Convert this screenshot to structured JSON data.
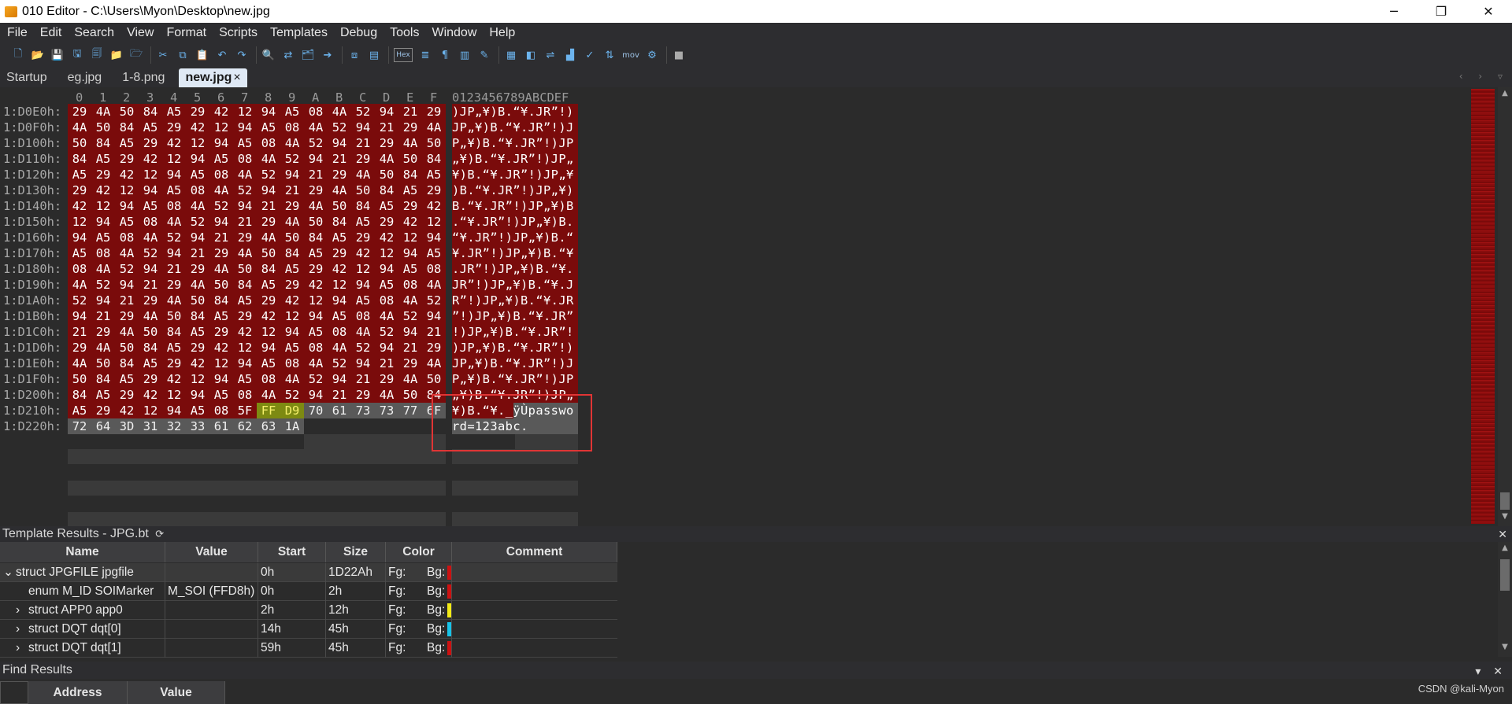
{
  "window": {
    "title": "010 Editor - C:\\Users\\Myon\\Desktop\\new.jpg",
    "minimize_glyph": "─",
    "restore_glyph": "❐",
    "close_glyph": "✕"
  },
  "menu": [
    "File",
    "Edit",
    "Search",
    "View",
    "Format",
    "Scripts",
    "Templates",
    "Debug",
    "Tools",
    "Window",
    "Help"
  ],
  "toolbar": {
    "icons": [
      "new-file-icon",
      "open-file-icon",
      "save-icon",
      "save-as-icon",
      "save-all-icon",
      "open-folder-icon",
      "open-project-icon",
      "cut-icon",
      "copy-icon",
      "paste-icon",
      "undo-icon",
      "redo-icon",
      "find-icon",
      "replace-icon",
      "find-in-files-icon",
      "goto-icon",
      "compare-icon",
      "template-icon",
      "hex-mode-icon",
      "text-mode-icon",
      "paragraph-icon",
      "columns-icon",
      "highlighter-icon",
      "calculator-icon",
      "inspector-icon",
      "convert-icon",
      "histogram-icon",
      "checksum-icon",
      "sort-icon",
      "mov-icon",
      "script-icon",
      "stop-icon"
    ],
    "hex_label": "Hex",
    "mov_label": "mov"
  },
  "tabs": [
    {
      "label": "Startup",
      "active": false
    },
    {
      "label": "eg.jpg",
      "active": false
    },
    {
      "label": "1-8.png",
      "active": false
    },
    {
      "label": "new.jpg",
      "active": true
    }
  ],
  "tab_close_glyph": "×",
  "hex": {
    "columns": [
      "0",
      "1",
      "2",
      "3",
      "4",
      "5",
      "6",
      "7",
      "8",
      "9",
      "A",
      "B",
      "C",
      "D",
      "E",
      "F"
    ],
    "ascii_header": "0123456789ABCDEF",
    "rows": [
      {
        "addr": "1:D0E0h:",
        "bytes": [
          "29",
          "4A",
          "50",
          "84",
          "A5",
          "29",
          "42",
          "12",
          "94",
          "A5",
          "08",
          "4A",
          "52",
          "94",
          "21",
          "29"
        ],
        "ascii": ")JP„¥)B.“¥.JR”!)"
      },
      {
        "addr": "1:D0F0h:",
        "bytes": [
          "4A",
          "50",
          "84",
          "A5",
          "29",
          "42",
          "12",
          "94",
          "A5",
          "08",
          "4A",
          "52",
          "94",
          "21",
          "29",
          "4A"
        ],
        "ascii": "JP„¥)B.“¥.JR”!)J"
      },
      {
        "addr": "1:D100h:",
        "bytes": [
          "50",
          "84",
          "A5",
          "29",
          "42",
          "12",
          "94",
          "A5",
          "08",
          "4A",
          "52",
          "94",
          "21",
          "29",
          "4A",
          "50"
        ],
        "ascii": "P„¥)B.“¥.JR”!)JP"
      },
      {
        "addr": "1:D110h:",
        "bytes": [
          "84",
          "A5",
          "29",
          "42",
          "12",
          "94",
          "A5",
          "08",
          "4A",
          "52",
          "94",
          "21",
          "29",
          "4A",
          "50",
          "84"
        ],
        "ascii": "„¥)B.“¥.JR”!)JP„"
      },
      {
        "addr": "1:D120h:",
        "bytes": [
          "A5",
          "29",
          "42",
          "12",
          "94",
          "A5",
          "08",
          "4A",
          "52",
          "94",
          "21",
          "29",
          "4A",
          "50",
          "84",
          "A5"
        ],
        "ascii": "¥)B.“¥.JR”!)JP„¥"
      },
      {
        "addr": "1:D130h:",
        "bytes": [
          "29",
          "42",
          "12",
          "94",
          "A5",
          "08",
          "4A",
          "52",
          "94",
          "21",
          "29",
          "4A",
          "50",
          "84",
          "A5",
          "29"
        ],
        "ascii": ")B.“¥.JR”!)JP„¥)"
      },
      {
        "addr": "1:D140h:",
        "bytes": [
          "42",
          "12",
          "94",
          "A5",
          "08",
          "4A",
          "52",
          "94",
          "21",
          "29",
          "4A",
          "50",
          "84",
          "A5",
          "29",
          "42"
        ],
        "ascii": "B.“¥.JR”!)JP„¥)B"
      },
      {
        "addr": "1:D150h:",
        "bytes": [
          "12",
          "94",
          "A5",
          "08",
          "4A",
          "52",
          "94",
          "21",
          "29",
          "4A",
          "50",
          "84",
          "A5",
          "29",
          "42",
          "12"
        ],
        "ascii": ".“¥.JR”!)JP„¥)B."
      },
      {
        "addr": "1:D160h:",
        "bytes": [
          "94",
          "A5",
          "08",
          "4A",
          "52",
          "94",
          "21",
          "29",
          "4A",
          "50",
          "84",
          "A5",
          "29",
          "42",
          "12",
          "94"
        ],
        "ascii": "“¥.JR”!)JP„¥)B.“"
      },
      {
        "addr": "1:D170h:",
        "bytes": [
          "A5",
          "08",
          "4A",
          "52",
          "94",
          "21",
          "29",
          "4A",
          "50",
          "84",
          "A5",
          "29",
          "42",
          "12",
          "94",
          "A5"
        ],
        "ascii": "¥.JR”!)JP„¥)B.“¥"
      },
      {
        "addr": "1:D180h:",
        "bytes": [
          "08",
          "4A",
          "52",
          "94",
          "21",
          "29",
          "4A",
          "50",
          "84",
          "A5",
          "29",
          "42",
          "12",
          "94",
          "A5",
          "08"
        ],
        "ascii": ".JR”!)JP„¥)B.“¥."
      },
      {
        "addr": "1:D190h:",
        "bytes": [
          "4A",
          "52",
          "94",
          "21",
          "29",
          "4A",
          "50",
          "84",
          "A5",
          "29",
          "42",
          "12",
          "94",
          "A5",
          "08",
          "4A"
        ],
        "ascii": "JR”!)JP„¥)B.“¥.J"
      },
      {
        "addr": "1:D1A0h:",
        "bytes": [
          "52",
          "94",
          "21",
          "29",
          "4A",
          "50",
          "84",
          "A5",
          "29",
          "42",
          "12",
          "94",
          "A5",
          "08",
          "4A",
          "52"
        ],
        "ascii": "R”!)JP„¥)B.“¥.JR"
      },
      {
        "addr": "1:D1B0h:",
        "bytes": [
          "94",
          "21",
          "29",
          "4A",
          "50",
          "84",
          "A5",
          "29",
          "42",
          "12",
          "94",
          "A5",
          "08",
          "4A",
          "52",
          "94"
        ],
        "ascii": "”!)JP„¥)B.“¥.JR”"
      },
      {
        "addr": "1:D1C0h:",
        "bytes": [
          "21",
          "29",
          "4A",
          "50",
          "84",
          "A5",
          "29",
          "42",
          "12",
          "94",
          "A5",
          "08",
          "4A",
          "52",
          "94",
          "21"
        ],
        "ascii": "!)JP„¥)B.“¥.JR”!"
      },
      {
        "addr": "1:D1D0h:",
        "bytes": [
          "29",
          "4A",
          "50",
          "84",
          "A5",
          "29",
          "42",
          "12",
          "94",
          "A5",
          "08",
          "4A",
          "52",
          "94",
          "21",
          "29"
        ],
        "ascii": ")JP„¥)B.“¥.JR”!)"
      },
      {
        "addr": "1:D1E0h:",
        "bytes": [
          "4A",
          "50",
          "84",
          "A5",
          "29",
          "42",
          "12",
          "94",
          "A5",
          "08",
          "4A",
          "52",
          "94",
          "21",
          "29",
          "4A"
        ],
        "ascii": "JP„¥)B.“¥.JR”!)J"
      },
      {
        "addr": "1:D1F0h:",
        "bytes": [
          "50",
          "84",
          "A5",
          "29",
          "42",
          "12",
          "94",
          "A5",
          "08",
          "4A",
          "52",
          "94",
          "21",
          "29",
          "4A",
          "50"
        ],
        "ascii": "P„¥)B.“¥.JR”!)JP"
      },
      {
        "addr": "1:D200h:",
        "bytes": [
          "84",
          "A5",
          "29",
          "42",
          "12",
          "94",
          "A5",
          "08",
          "4A",
          "52",
          "94",
          "21",
          "29",
          "4A",
          "50",
          "84"
        ],
        "ascii": "„¥)B.“¥.JR”!)JP„"
      },
      {
        "addr": "1:D210h:",
        "bytes": [
          "A5",
          "29",
          "42",
          "12",
          "94",
          "A5",
          "08",
          "5F",
          "FF",
          "D9",
          "70",
          "61",
          "73",
          "73",
          "77",
          "6F"
        ],
        "ascii": "¥)B.“¥._ÿÙpasswo"
      },
      {
        "addr": "1:D220h:",
        "bytes": [
          "72",
          "64",
          "3D",
          "31",
          "32",
          "33",
          "61",
          "62",
          "63",
          "1A"
        ],
        "ascii": "rd=123abc."
      }
    ]
  },
  "template_results": {
    "title": "Template Results - JPG.bt",
    "refresh_glyph": "⟳",
    "close_glyph": "✕",
    "headers": [
      "Name",
      "Value",
      "Start",
      "Size",
      "Color",
      "Comment"
    ],
    "rows": [
      {
        "expander": "⌄",
        "name": "struct JPGFILE jpgfile",
        "value": "",
        "start": "0h",
        "size": "1D22Ah",
        "fg": "Fg:",
        "bg": "Bg:",
        "bg_color": "#cc1111",
        "indent": 0
      },
      {
        "expander": "",
        "name": "enum M_ID SOIMarker",
        "value": "M_SOI (FFD8h)",
        "start": "0h",
        "size": "2h",
        "fg": "Fg:",
        "bg": "Bg:",
        "bg_color": "#cc1111",
        "indent": 2
      },
      {
        "expander": "›",
        "name": "struct APP0 app0",
        "value": "",
        "start": "2h",
        "size": "12h",
        "fg": "Fg:",
        "bg": "Bg:",
        "bg_color": "#f2ea16",
        "indent": 1
      },
      {
        "expander": "›",
        "name": "struct DQT dqt[0]",
        "value": "",
        "start": "14h",
        "size": "45h",
        "fg": "Fg:",
        "bg": "Bg:",
        "bg_color": "#17c3e8",
        "indent": 1
      },
      {
        "expander": "›",
        "name": "struct DQT dqt[1]",
        "value": "",
        "start": "59h",
        "size": "45h",
        "fg": "Fg:",
        "bg": "Bg:",
        "bg_color": "#cc1111",
        "indent": 1
      }
    ]
  },
  "find_results": {
    "title": "Find Results",
    "close_glyph": "▾ ✕",
    "headers": [
      "Address",
      "Value"
    ]
  },
  "watermark": "CSDN @kali-Myon"
}
